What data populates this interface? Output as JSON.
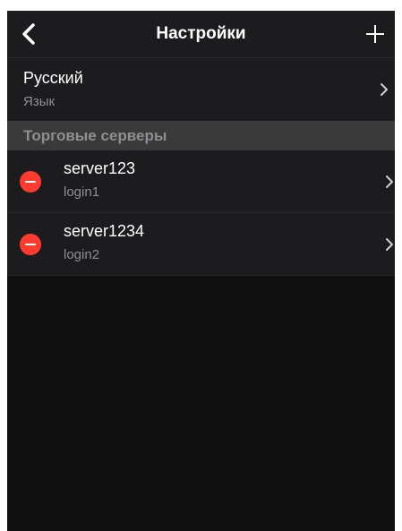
{
  "navbar": {
    "title": "Настройки",
    "back_icon": "chevron-left-icon",
    "add_icon": "plus-icon"
  },
  "language": {
    "value": "Русский",
    "label": "Язык"
  },
  "section": {
    "title": "Торговые серверы"
  },
  "servers": [
    {
      "name": "server123",
      "login": "login1"
    },
    {
      "name": "server1234",
      "login": "login2"
    }
  ],
  "colors": {
    "background": "#101010",
    "row": "#1c1c1e",
    "section_header": "#3a3a3a",
    "delete": "#ff3b30",
    "secondary_text": "#8e8e93"
  }
}
